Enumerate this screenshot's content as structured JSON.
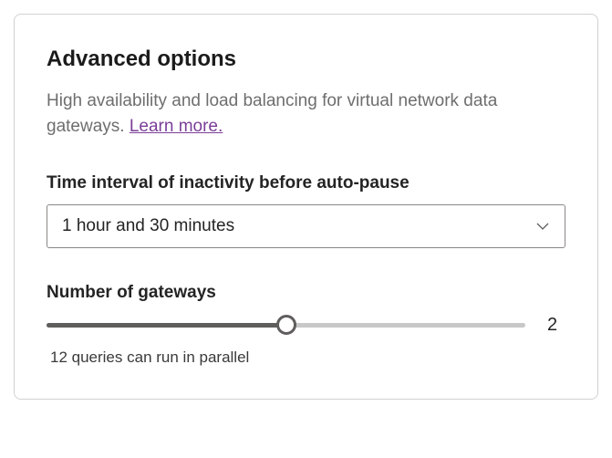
{
  "section": {
    "title": "Advanced options",
    "description_pre": "High availability and load balancing for virtual network data gateways. ",
    "learn_more_label": "Learn more."
  },
  "time_interval": {
    "label": "Time interval of inactivity before auto-pause",
    "selected": "1 hour and 30 minutes"
  },
  "gateways": {
    "label": "Number of gateways",
    "value": "2",
    "helper": "12 queries can run in parallel"
  }
}
